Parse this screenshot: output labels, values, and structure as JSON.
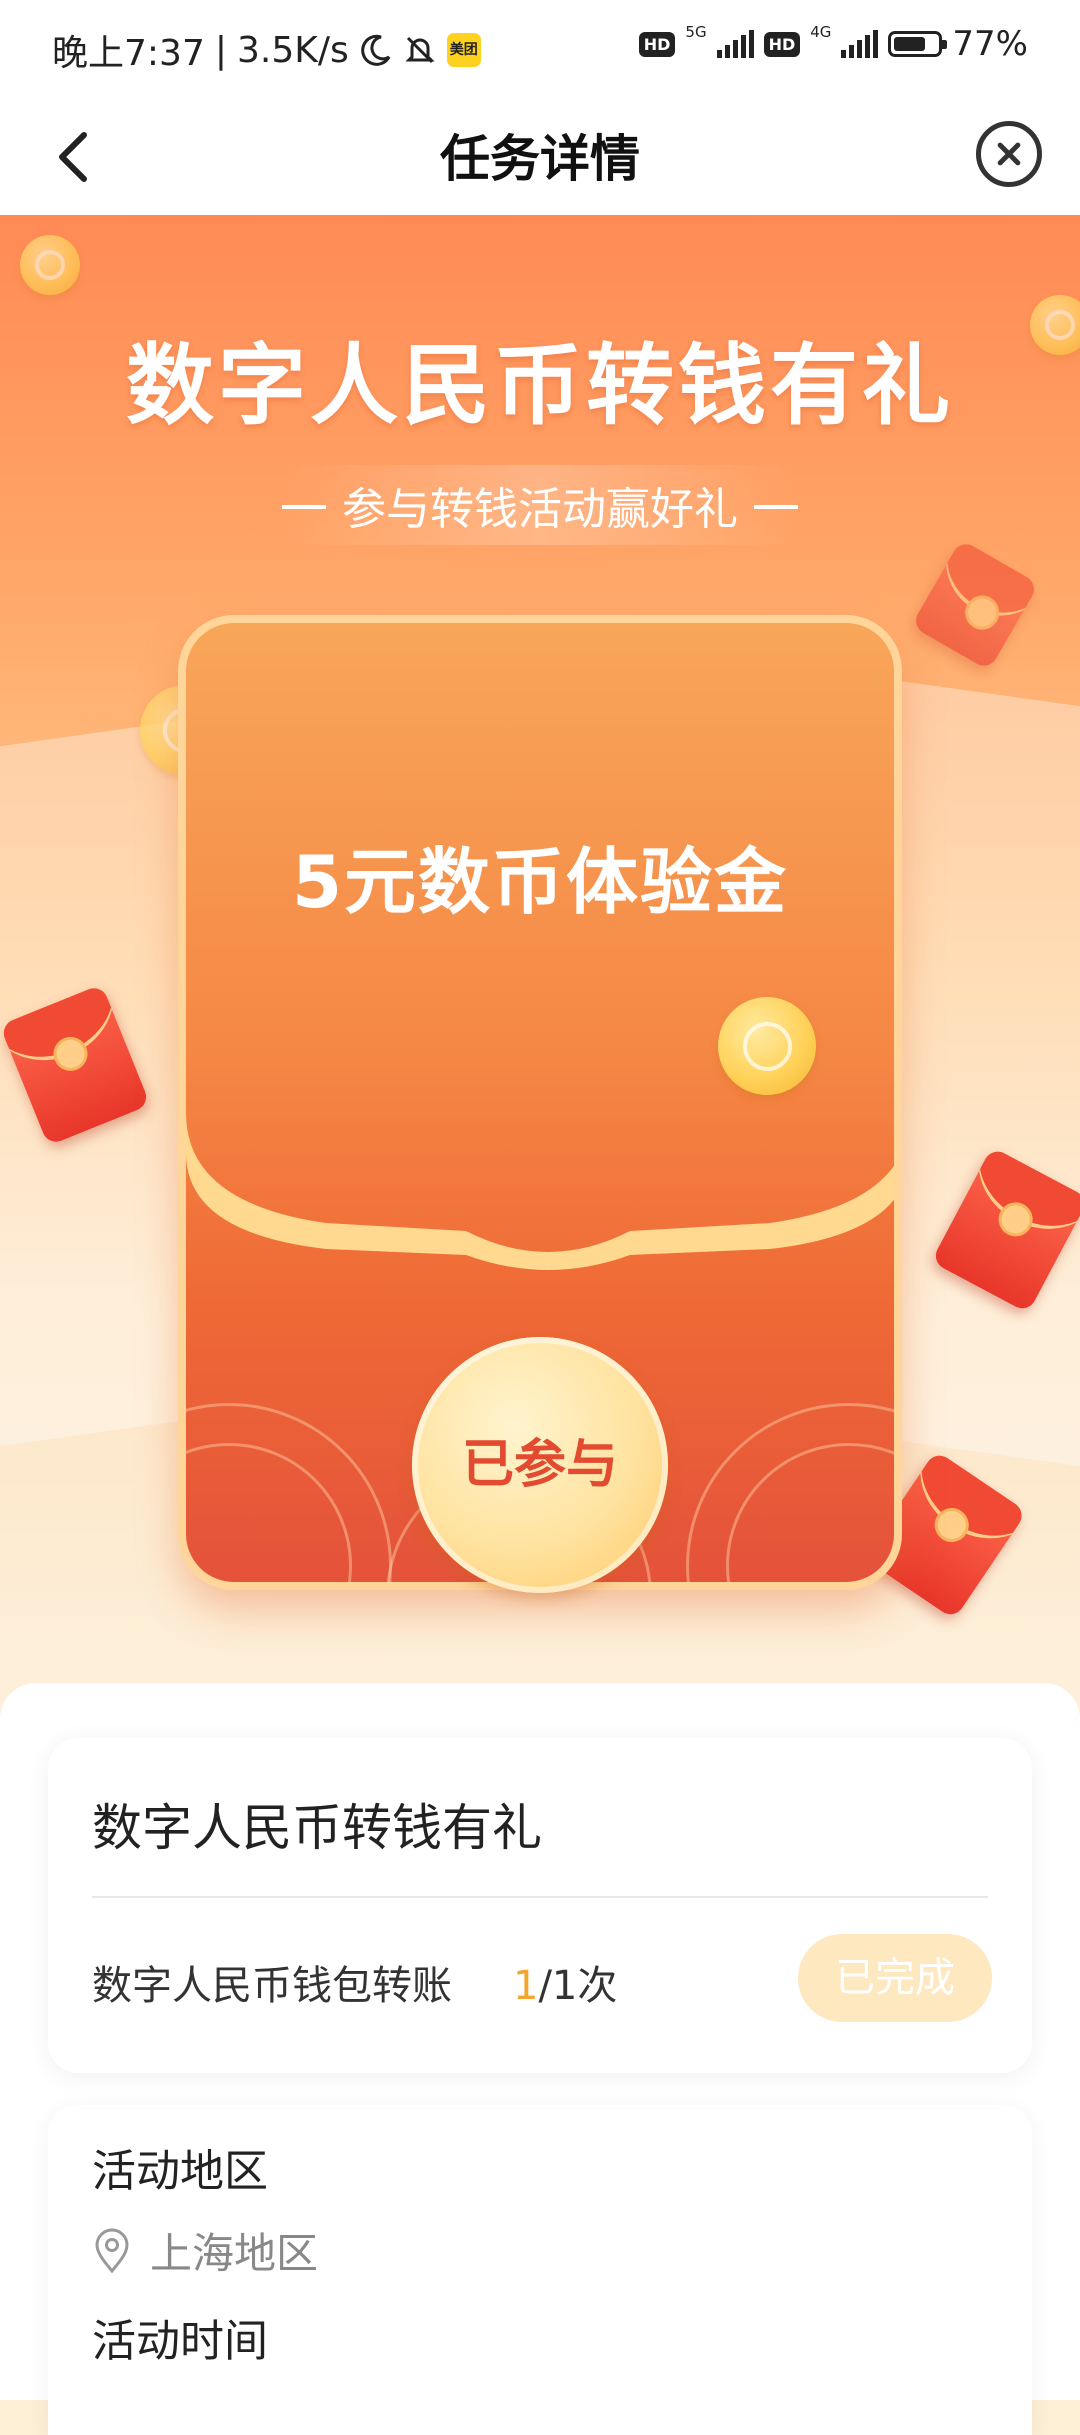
{
  "status_bar": {
    "time": "晚上7:37",
    "speed": "3.5K/s",
    "app_badge": "美团",
    "network_1": "5G",
    "network_2": "4G",
    "hd": "HD",
    "battery": "77%",
    "battery_level": 0.77
  },
  "nav": {
    "title": "任务详情"
  },
  "banner": {
    "title": "数字人民币转钱有礼",
    "subtitle": "参与转钱活动赢好礼",
    "reward": "5元数币体验金",
    "joined_label": "已参与"
  },
  "task": {
    "title": "数字人民币转钱有礼",
    "item_label": "数字人民币钱包转账",
    "progress_current": "1",
    "progress_total": "/1次",
    "status_button": "已完成"
  },
  "info": {
    "region_label": "活动地区",
    "region_value": "上海地区",
    "time_label": "活动时间"
  },
  "colors": {
    "banner_top": "#ff8a55",
    "accent_orange": "#f3a62b",
    "joined_text": "#e24b2f",
    "done_button_bg": "#fde8bf"
  }
}
